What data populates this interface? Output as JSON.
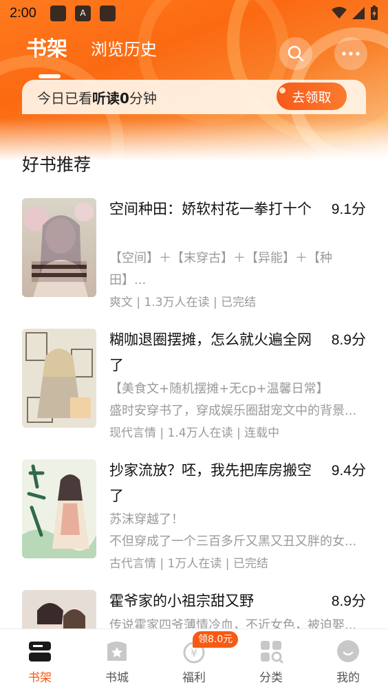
{
  "status_bar": {
    "time": "2:00"
  },
  "header": {
    "tabs": [
      {
        "label": "书架",
        "active": true
      },
      {
        "label": "浏览历史",
        "active": false
      }
    ],
    "search_icon": "search-icon",
    "more_icon": "more-icon"
  },
  "read_banner": {
    "prefix": "今日已看",
    "highlight": "听读0",
    "suffix": "分钟",
    "claim_label": "去领取"
  },
  "section": {
    "title": "好书推荐"
  },
  "books": [
    {
      "title": "空间种田：娇软村花一拳打十个",
      "score": "9.1分",
      "desc1": "【空间】＋【末穿古】＋【异能】＋【种",
      "desc2": "田】...",
      "meta": "爽文 | 1.3万人在读 | 已完结"
    },
    {
      "title": "糊咖退圈摆摊，怎么就火遍全网了",
      "score": "8.9分",
      "desc1": "【美食文+随机摆摊+无cp+温馨日常】",
      "desc2": "盛时安穿书了，穿成娱乐圈甜宠文中的背景...",
      "meta": "现代言情 | 1.4万人在读 | 连载中"
    },
    {
      "title": "抄家流放？呸，我先把库房搬空了",
      "score": "9.4分",
      "desc1": "苏沫穿越了！",
      "desc2": "不但穿成了一个三百多斤又黑又丑又胖的女...",
      "meta": "古代言情 | 1万人在读 | 已完结"
    },
    {
      "title": "霍爷家的小祖宗甜又野",
      "score": "8.9分",
      "desc1": "传说霍家四爷薄情冷血，不近女色，被迫娶...",
      "desc2": "",
      "meta": ""
    }
  ],
  "bottom_nav": {
    "items": [
      {
        "label": "书架",
        "active": true
      },
      {
        "label": "书城",
        "active": false
      },
      {
        "label": "福利",
        "active": false
      },
      {
        "label": "分类",
        "active": false
      },
      {
        "label": "我的",
        "active": false
      }
    ],
    "welfare_badge": "领8.0元"
  },
  "colors": {
    "accent": "#f65a14",
    "hero": "#fb6a12"
  }
}
